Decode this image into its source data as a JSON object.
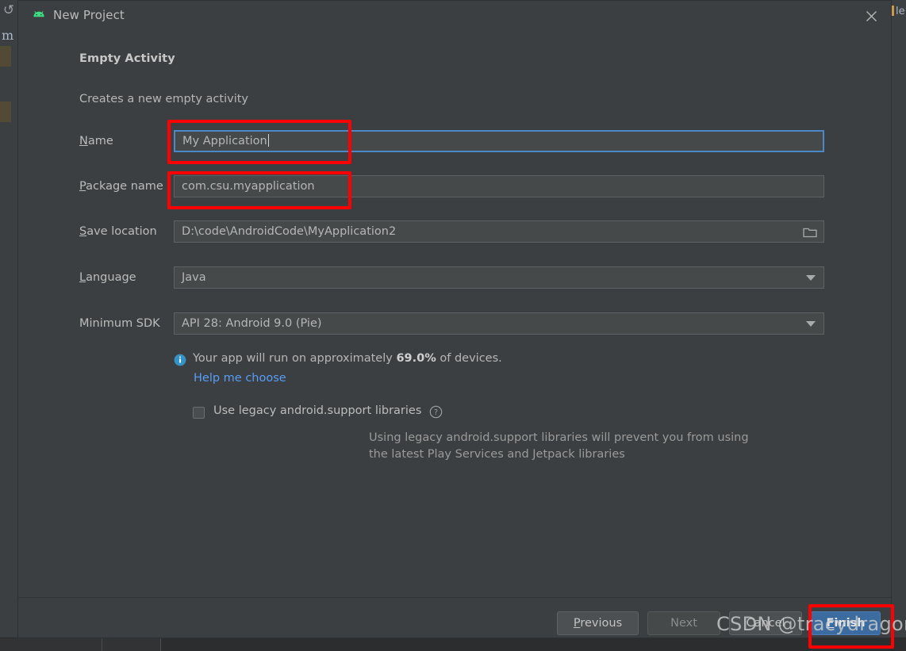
{
  "window": {
    "title": "New Project",
    "app_icon": "android-robot-icon",
    "close_icon": "close-icon",
    "accent_blue": "#4a88c7",
    "annotation_red": "#fe0000",
    "background": "#3c3f41"
  },
  "header": {
    "title": "Empty Activity",
    "subtitle": "Creates a new empty activity"
  },
  "form": {
    "fields": [
      {
        "label_prefix": "N",
        "label_rest": "ame",
        "name": "name",
        "value": "My Application",
        "type": "text",
        "focused": true,
        "annotated": true
      },
      {
        "label_prefix": "P",
        "label_rest": "ackage name",
        "name": "package-name",
        "value": "com.csu.myapplication",
        "type": "text",
        "focused": false,
        "annotated": true
      },
      {
        "label_prefix": "S",
        "label_rest": "ave location",
        "name": "save-location",
        "value": "D:\\code\\AndroidCode\\MyApplication2",
        "type": "path",
        "icon": "folder-icon",
        "focused": false,
        "annotated": false
      },
      {
        "label_prefix": "L",
        "label_rest": "anguage",
        "name": "language",
        "value": "Java",
        "type": "dropdown",
        "icon": "chevron-down-icon",
        "focused": false,
        "annotated": false
      },
      {
        "label_prefix": "",
        "label_rest": "Minimum SDK",
        "name": "minimum-sdk",
        "value": "API 28: Android 9.0 (Pie)",
        "type": "dropdown",
        "icon": "chevron-down-icon",
        "focused": false,
        "annotated": false
      }
    ]
  },
  "info": {
    "icon": "info-icon",
    "text_before": "Your app will run on approximately ",
    "percent": "69.0%",
    "text_after": " of devices.",
    "link": "Help me choose"
  },
  "legacy": {
    "checkbox_label": "Use legacy android.support libraries",
    "checked": false,
    "help_icon": "question-mark-icon",
    "description_line1": "Using legacy android.support libraries will prevent you from using",
    "description_line2": "the latest Play Services and Jetpack libraries"
  },
  "footer": {
    "previous": {
      "prefix": "P",
      "rest": "revious",
      "enabled": true
    },
    "next": {
      "label": "Next",
      "enabled": false
    },
    "cancel": {
      "label": "Cancel",
      "enabled": true
    },
    "finish": {
      "prefix": "F",
      "rest": "inish",
      "enabled": true,
      "primary": true,
      "annotated": true
    }
  },
  "watermark": {
    "text": "CSDN @tracydragonlxy"
  }
}
